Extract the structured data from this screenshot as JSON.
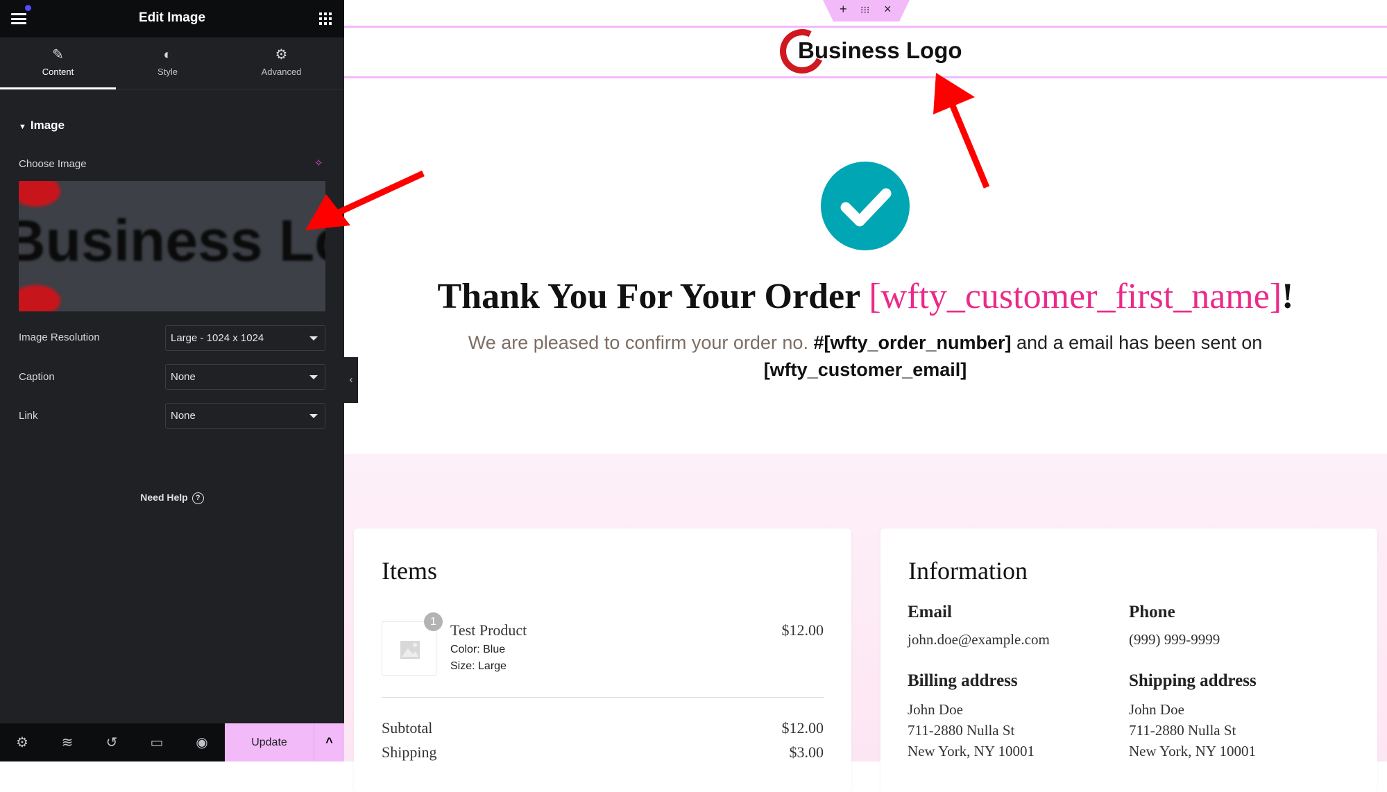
{
  "panel": {
    "title": "Edit Image",
    "tabs": [
      {
        "label": "Content",
        "icon": "pencil-icon",
        "active": true
      },
      {
        "label": "Style",
        "icon": "half-circle-icon",
        "active": false
      },
      {
        "label": "Advanced",
        "icon": "gear-icon",
        "active": false
      }
    ],
    "section": "Image",
    "choose_image_label": "Choose Image",
    "preview_text": "Business Lo",
    "fields": [
      {
        "label": "Image Resolution",
        "value": "Large - 1024 x 1024"
      },
      {
        "label": "Caption",
        "value": "None"
      },
      {
        "label": "Link",
        "value": "None"
      }
    ],
    "help": "Need Help",
    "footer": {
      "update_label": "Update",
      "icons": [
        "gear-icon",
        "layers-icon",
        "history-icon",
        "responsive-icon",
        "eye-icon"
      ]
    },
    "accent": "#f2baf9"
  },
  "canvas": {
    "logo_text": "Business Logo",
    "heading_prefix": "Thank You For Your Order ",
    "heading_name": "[wfty_customer_first_name]",
    "heading_suffix": "!",
    "sub_prefix": "We are pleased to confirm your order no. ",
    "sub_order": "#[wfty_order_number]",
    "sub_mid": " and a email has been sent on",
    "sub_email": "[wfty_customer_email]",
    "colors": {
      "check": "#00a6b4",
      "highlight": "#ea2a8a"
    },
    "items": {
      "title": "Items",
      "product": {
        "qty": "1",
        "name": "Test Product",
        "color": "Color: Blue",
        "size": "Size: Large",
        "price": "$12.00"
      },
      "totals": [
        {
          "label": "Subtotal",
          "value": "$12.00"
        },
        {
          "label": "Shipping",
          "value": "$3.00"
        }
      ]
    },
    "info": {
      "title": "Information",
      "email_label": "Email",
      "email": "john.doe@example.com",
      "phone_label": "Phone",
      "phone": "(999) 999-9999",
      "billing_label": "Billing address",
      "billing": [
        "John Doe",
        "711-2880 Nulla St",
        "New York, NY 10001"
      ],
      "shipping_label": "Shipping address",
      "shipping": [
        "John Doe",
        "711-2880 Nulla St",
        "New York, NY 10001"
      ]
    }
  }
}
